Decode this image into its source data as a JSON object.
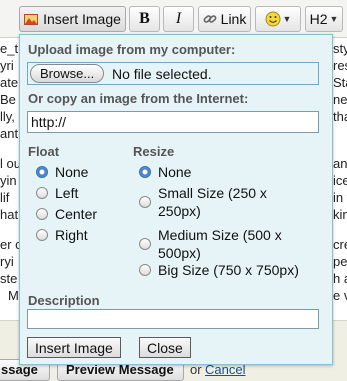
{
  "toolbar": {
    "insert_image_label": "Insert Image",
    "bold_label": "B",
    "italic_label": "I",
    "link_label": "Link",
    "heading_label": "H2"
  },
  "background_lines": [
    "e_t",
    "styl",
    "yri",
    "res",
    "ate",
    "Sta",
    "Be",
    "nev",
    "lly,",
    "tha",
    "ant",
    "",
    "l ou",
    "anc",
    "yin",
    "ice",
    "lif",
    "in f",
    "hat",
    "king",
    "",
    "er c",
    "cre",
    "ryi",
    "pe",
    "ste",
    "h a",
    "M",
    "e v"
  ],
  "bottom_strip": {
    "left_button": "ssage",
    "preview_button": "Preview Message",
    "or_text": "or",
    "cancel_link": "Cancel"
  },
  "dialog": {
    "upload_label": "Upload image from my computer:",
    "browse_label": "Browse...",
    "file_status": "No file selected.",
    "copy_label": "Or copy an image from the Internet:",
    "url_value": "http://",
    "float_label": "Float",
    "float_options": [
      "None",
      "Left",
      "Center",
      "Right"
    ],
    "float_selected": "None",
    "resize_label": "Resize",
    "resize_options": [
      [
        "None"
      ],
      [
        "Small Size (250 x",
        "250px)"
      ],
      [
        "Medium Size (500 x",
        "500px)"
      ],
      [
        "Big Size (750 x 750px)"
      ]
    ],
    "resize_selected": "None",
    "description_label": "Description",
    "description_value": "",
    "insert_button": "Insert Image",
    "close_button": "Close"
  }
}
